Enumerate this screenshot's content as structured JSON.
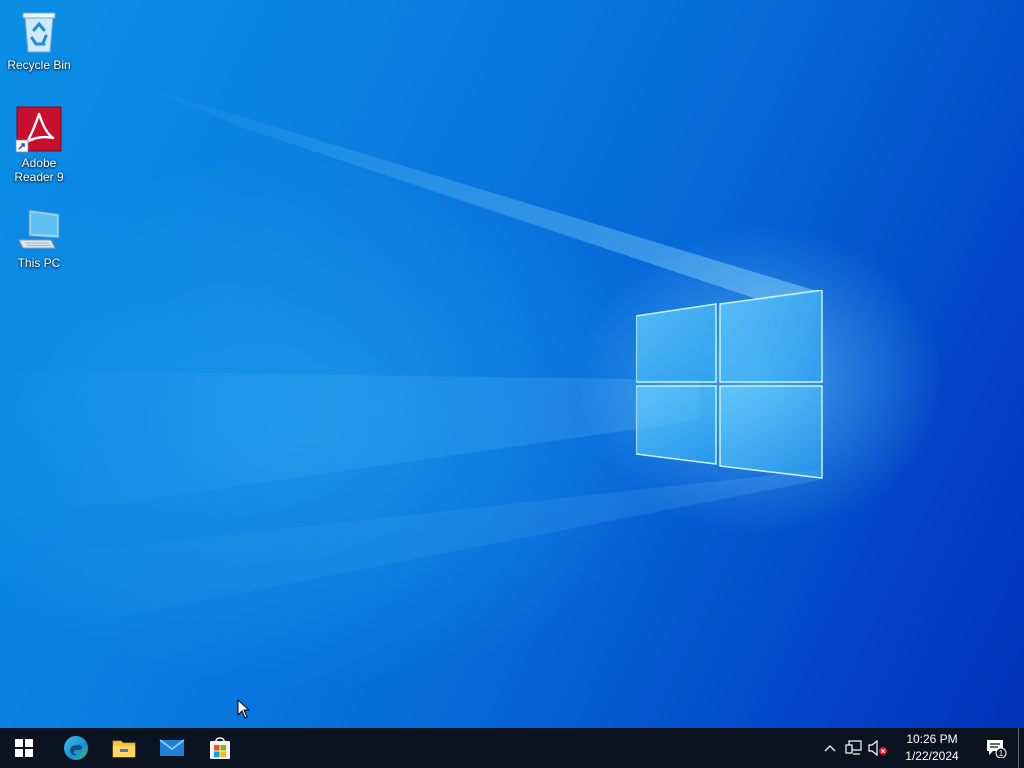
{
  "desktop": {
    "icons": [
      {
        "label": "Recycle Bin",
        "icon": "recycle-bin-icon"
      },
      {
        "label": "Adobe Reader 9",
        "icon": "adobe-reader-icon"
      },
      {
        "label": "This PC",
        "icon": "this-pc-icon"
      }
    ]
  },
  "taskbar": {
    "start": {
      "icon": "windows-start-icon"
    },
    "pinned": [
      {
        "icon": "edge-icon"
      },
      {
        "icon": "file-explorer-icon"
      },
      {
        "icon": "mail-icon"
      },
      {
        "icon": "microsoft-store-icon"
      }
    ],
    "tray": {
      "icons": [
        "chevron-up-icon",
        "network-icon",
        "volume-muted-icon"
      ],
      "time": "10:26 PM",
      "date": "1/22/2024",
      "notification_count": "1"
    }
  },
  "colors": {
    "taskbar_bg": "#0b1220",
    "desktop_blue": "#0a7fe0",
    "adobe_red": "#c8102e"
  }
}
